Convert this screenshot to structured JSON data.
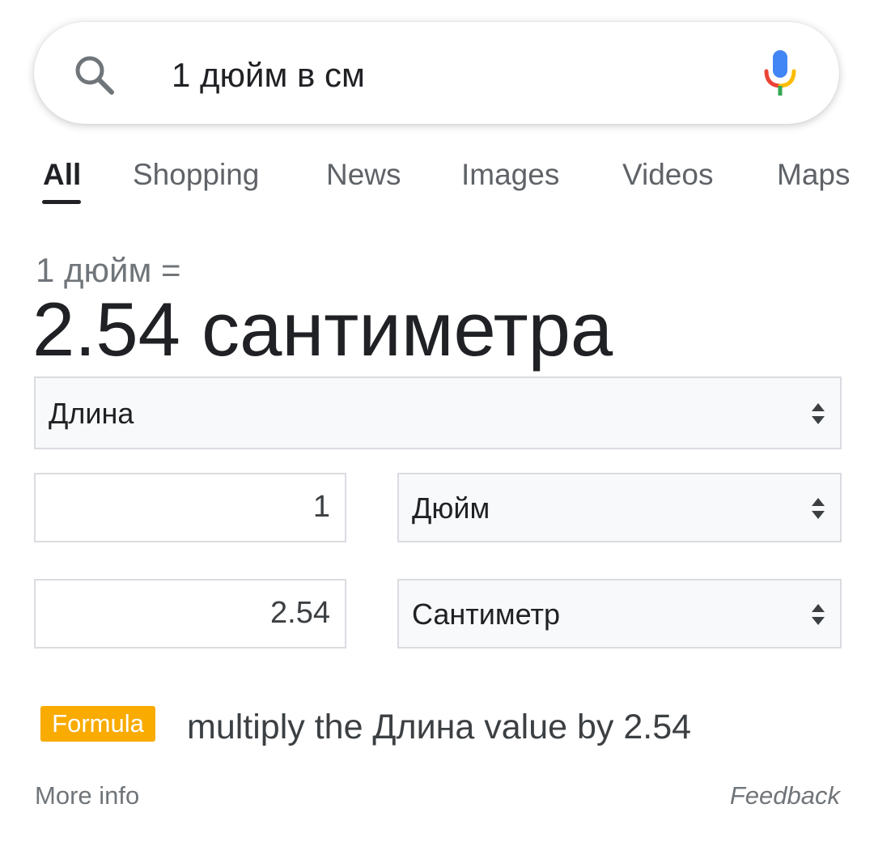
{
  "search": {
    "query": "1 дюйм в см"
  },
  "tabs": [
    {
      "label": "All",
      "active": true
    },
    {
      "label": "Shopping",
      "active": false
    },
    {
      "label": "News",
      "active": false
    },
    {
      "label": "Images",
      "active": false
    },
    {
      "label": "Videos",
      "active": false
    },
    {
      "label": "Maps",
      "active": false
    }
  ],
  "result": {
    "from_text": "1 дюйм =",
    "answer_text": "2.54 сантиметра"
  },
  "converter": {
    "category": "Длина",
    "from_value": "1",
    "from_unit": "Дюйм",
    "to_value": "2.54",
    "to_unit": "Сантиметр"
  },
  "formula": {
    "badge": "Formula",
    "text": "multiply the Длина value by 2.54",
    "badge_color": "#f9ab00"
  },
  "footer": {
    "more_info": "More info",
    "feedback": "Feedback"
  },
  "icons": {
    "search": "search-icon",
    "mic": "microphone-icon",
    "updown": "up-down-arrows-icon"
  }
}
